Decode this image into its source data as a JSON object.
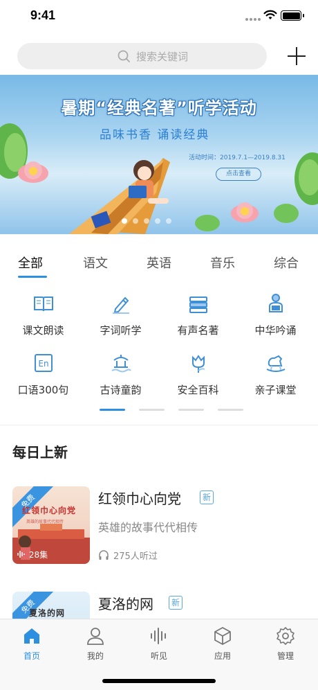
{
  "status": {
    "time": "9:41"
  },
  "search": {
    "placeholder": "搜索关键词"
  },
  "banner": {
    "title": "暑期“经典名著”听学活动",
    "subtitle": "品味书香  诵读经典",
    "date": "活动时间：2019.7.1—2019.8.31",
    "button": "点击查看",
    "slides": 5,
    "active_slide": 1
  },
  "tabs": [
    {
      "label": "全部",
      "active": true
    },
    {
      "label": "语文"
    },
    {
      "label": "英语"
    },
    {
      "label": "音乐"
    },
    {
      "label": "综合"
    }
  ],
  "grid": [
    {
      "label": "课文朗读",
      "icon": "book-open-icon"
    },
    {
      "label": "字词听学",
      "icon": "pencil-icon"
    },
    {
      "label": "有声名著",
      "icon": "book-stack-icon"
    },
    {
      "label": "中华吟诵",
      "icon": "reader-icon"
    },
    {
      "label": "口语300句",
      "icon": "en-icon"
    },
    {
      "label": "古诗童韵",
      "icon": "pavilion-icon"
    },
    {
      "label": "安全百科",
      "icon": "tulip-icon"
    },
    {
      "label": "亲子课堂",
      "icon": "rocking-horse-icon"
    }
  ],
  "grid_pages": {
    "count": 4,
    "active": 1
  },
  "section": {
    "title": "每日上新"
  },
  "cards": [
    {
      "title": "红领巾心向党",
      "badge": "新",
      "desc": "英雄的故事代代相传",
      "listeners": "275人听过",
      "cover_title": "红领巾心向党",
      "cover_sub": "英雄的故事代代相传",
      "ribbon": "免费",
      "episodes": "28集"
    },
    {
      "title": "夏洛的网",
      "badge": "新",
      "cover_title": "夏洛的网",
      "ribbon": "免费"
    }
  ],
  "tabbar": [
    {
      "label": "首页",
      "icon": "home-icon",
      "active": true
    },
    {
      "label": "我的",
      "icon": "person-icon"
    },
    {
      "label": "听见",
      "icon": "sound-wave-icon"
    },
    {
      "label": "应用",
      "icon": "cube-icon"
    },
    {
      "label": "管理",
      "icon": "settings-icon"
    }
  ],
  "colors": {
    "accent": "#2d8fe0",
    "badge": "#58a7e8"
  }
}
